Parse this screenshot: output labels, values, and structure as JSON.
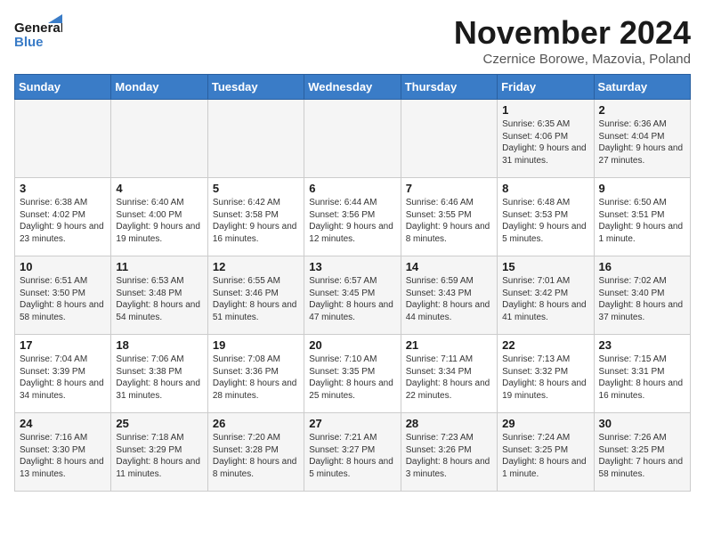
{
  "header": {
    "logo_general": "General",
    "logo_blue": "Blue",
    "title": "November 2024",
    "location": "Czernice Borowe, Mazovia, Poland"
  },
  "weekdays": [
    "Sunday",
    "Monday",
    "Tuesday",
    "Wednesday",
    "Thursday",
    "Friday",
    "Saturday"
  ],
  "weeks": [
    [
      {
        "day": "",
        "info": ""
      },
      {
        "day": "",
        "info": ""
      },
      {
        "day": "",
        "info": ""
      },
      {
        "day": "",
        "info": ""
      },
      {
        "day": "",
        "info": ""
      },
      {
        "day": "1",
        "info": "Sunrise: 6:35 AM\nSunset: 4:06 PM\nDaylight: 9 hours and 31 minutes."
      },
      {
        "day": "2",
        "info": "Sunrise: 6:36 AM\nSunset: 4:04 PM\nDaylight: 9 hours and 27 minutes."
      }
    ],
    [
      {
        "day": "3",
        "info": "Sunrise: 6:38 AM\nSunset: 4:02 PM\nDaylight: 9 hours and 23 minutes."
      },
      {
        "day": "4",
        "info": "Sunrise: 6:40 AM\nSunset: 4:00 PM\nDaylight: 9 hours and 19 minutes."
      },
      {
        "day": "5",
        "info": "Sunrise: 6:42 AM\nSunset: 3:58 PM\nDaylight: 9 hours and 16 minutes."
      },
      {
        "day": "6",
        "info": "Sunrise: 6:44 AM\nSunset: 3:56 PM\nDaylight: 9 hours and 12 minutes."
      },
      {
        "day": "7",
        "info": "Sunrise: 6:46 AM\nSunset: 3:55 PM\nDaylight: 9 hours and 8 minutes."
      },
      {
        "day": "8",
        "info": "Sunrise: 6:48 AM\nSunset: 3:53 PM\nDaylight: 9 hours and 5 minutes."
      },
      {
        "day": "9",
        "info": "Sunrise: 6:50 AM\nSunset: 3:51 PM\nDaylight: 9 hours and 1 minute."
      }
    ],
    [
      {
        "day": "10",
        "info": "Sunrise: 6:51 AM\nSunset: 3:50 PM\nDaylight: 8 hours and 58 minutes."
      },
      {
        "day": "11",
        "info": "Sunrise: 6:53 AM\nSunset: 3:48 PM\nDaylight: 8 hours and 54 minutes."
      },
      {
        "day": "12",
        "info": "Sunrise: 6:55 AM\nSunset: 3:46 PM\nDaylight: 8 hours and 51 minutes."
      },
      {
        "day": "13",
        "info": "Sunrise: 6:57 AM\nSunset: 3:45 PM\nDaylight: 8 hours and 47 minutes."
      },
      {
        "day": "14",
        "info": "Sunrise: 6:59 AM\nSunset: 3:43 PM\nDaylight: 8 hours and 44 minutes."
      },
      {
        "day": "15",
        "info": "Sunrise: 7:01 AM\nSunset: 3:42 PM\nDaylight: 8 hours and 41 minutes."
      },
      {
        "day": "16",
        "info": "Sunrise: 7:02 AM\nSunset: 3:40 PM\nDaylight: 8 hours and 37 minutes."
      }
    ],
    [
      {
        "day": "17",
        "info": "Sunrise: 7:04 AM\nSunset: 3:39 PM\nDaylight: 8 hours and 34 minutes."
      },
      {
        "day": "18",
        "info": "Sunrise: 7:06 AM\nSunset: 3:38 PM\nDaylight: 8 hours and 31 minutes."
      },
      {
        "day": "19",
        "info": "Sunrise: 7:08 AM\nSunset: 3:36 PM\nDaylight: 8 hours and 28 minutes."
      },
      {
        "day": "20",
        "info": "Sunrise: 7:10 AM\nSunset: 3:35 PM\nDaylight: 8 hours and 25 minutes."
      },
      {
        "day": "21",
        "info": "Sunrise: 7:11 AM\nSunset: 3:34 PM\nDaylight: 8 hours and 22 minutes."
      },
      {
        "day": "22",
        "info": "Sunrise: 7:13 AM\nSunset: 3:32 PM\nDaylight: 8 hours and 19 minutes."
      },
      {
        "day": "23",
        "info": "Sunrise: 7:15 AM\nSunset: 3:31 PM\nDaylight: 8 hours and 16 minutes."
      }
    ],
    [
      {
        "day": "24",
        "info": "Sunrise: 7:16 AM\nSunset: 3:30 PM\nDaylight: 8 hours and 13 minutes."
      },
      {
        "day": "25",
        "info": "Sunrise: 7:18 AM\nSunset: 3:29 PM\nDaylight: 8 hours and 11 minutes."
      },
      {
        "day": "26",
        "info": "Sunrise: 7:20 AM\nSunset: 3:28 PM\nDaylight: 8 hours and 8 minutes."
      },
      {
        "day": "27",
        "info": "Sunrise: 7:21 AM\nSunset: 3:27 PM\nDaylight: 8 hours and 5 minutes."
      },
      {
        "day": "28",
        "info": "Sunrise: 7:23 AM\nSunset: 3:26 PM\nDaylight: 8 hours and 3 minutes."
      },
      {
        "day": "29",
        "info": "Sunrise: 7:24 AM\nSunset: 3:25 PM\nDaylight: 8 hours and 1 minute."
      },
      {
        "day": "30",
        "info": "Sunrise: 7:26 AM\nSunset: 3:25 PM\nDaylight: 7 hours and 58 minutes."
      }
    ]
  ]
}
